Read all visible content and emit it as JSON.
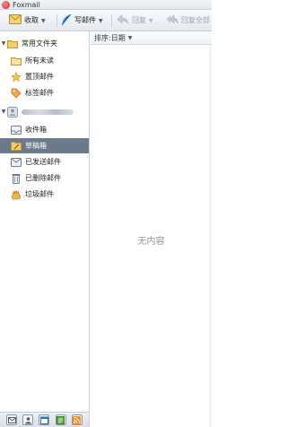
{
  "window": {
    "title": "Foxmail"
  },
  "toolbar": {
    "receive_label": "收取",
    "compose_label": "写邮件",
    "reply_label": "回复",
    "reply_all_label": "回复全部"
  },
  "sidebar": {
    "folders_group_label": "常用文件夹",
    "folders": [
      {
        "label": "所有未读",
        "icon": "folder-icon"
      },
      {
        "label": "置顶邮件",
        "icon": "star-icon"
      },
      {
        "label": "标签邮件",
        "icon": "tag-icon"
      }
    ],
    "account_items": [
      {
        "label": "收件箱",
        "icon": "inbox-icon"
      },
      {
        "label": "草稿箱",
        "icon": "drafts-icon",
        "selected": true
      },
      {
        "label": "已发送邮件",
        "icon": "sent-icon"
      },
      {
        "label": "已删除邮件",
        "icon": "trash-icon"
      },
      {
        "label": "垃圾邮件",
        "icon": "spam-icon"
      }
    ]
  },
  "bottombar": {
    "icons": [
      "mail-icon",
      "contacts-icon",
      "calendar-icon",
      "notes-icon",
      "rss-icon"
    ]
  },
  "list": {
    "sort_label": "排序:日期",
    "empty_text": "无内容"
  },
  "colors": {
    "selection": "#6b7a8c",
    "compose_blue": "#2f7fd8",
    "folder_yellow": "#e8b84a"
  }
}
